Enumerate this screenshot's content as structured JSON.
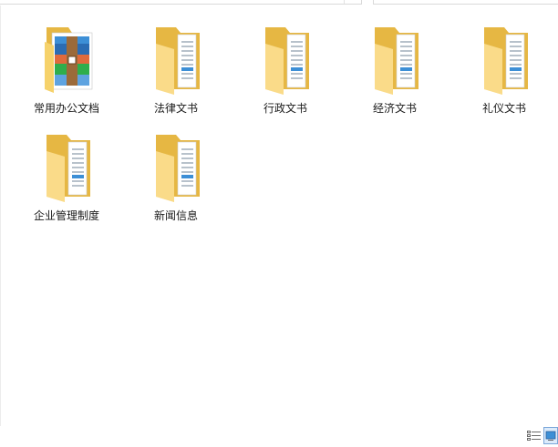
{
  "folders": [
    {
      "label": "常用办公文档",
      "icon": "archive-folder-icon"
    },
    {
      "label": "法律文书",
      "icon": "folder-icon"
    },
    {
      "label": "行政文书",
      "icon": "folder-icon"
    },
    {
      "label": "经济文书",
      "icon": "folder-icon"
    },
    {
      "label": "礼仪文书",
      "icon": "folder-icon"
    },
    {
      "label": "企业管理制度",
      "icon": "folder-icon"
    },
    {
      "label": "新闻信息",
      "icon": "folder-icon"
    }
  ],
  "colors": {
    "folder_back": "#e8bb4a",
    "folder_front": "#f8d778",
    "accent_blue": "#3d8fd6"
  },
  "statusbar": {
    "view_details_icon": "details-view-icon",
    "view_tiles_icon": "large-icons-view-icon"
  }
}
